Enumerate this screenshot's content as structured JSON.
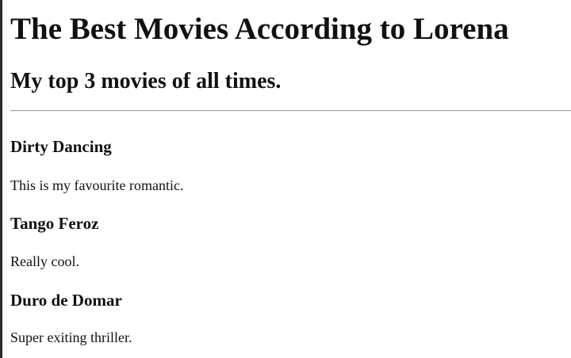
{
  "page": {
    "title": "The Best Movies According to Lorena",
    "subtitle": "My top 3 movies of all times."
  },
  "movies": [
    {
      "title": "Dirty Dancing",
      "description": "This is my favourite romantic."
    },
    {
      "title": "Tango Feroz",
      "description": "Really cool."
    },
    {
      "title": "Duro de Domar",
      "description": "Super exiting thriller."
    }
  ]
}
